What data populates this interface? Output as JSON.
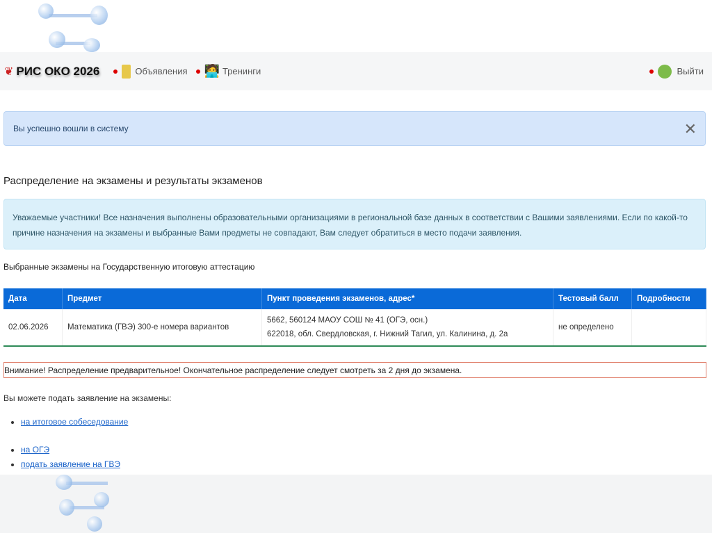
{
  "nav": {
    "brand": "РИС ОКО 2026",
    "items": [
      "Объявления",
      "Тренинги"
    ],
    "logout": "Выйти"
  },
  "alert": {
    "text": "Вы успешно вошли в систему",
    "close": "✕"
  },
  "page_title": "Распределение на экзамены и результаты экзаменов",
  "info": "Уважаемые участники! Все назначения выполнены образовательными организациями в региональной базе данных в соответствии с Вашими заявлениями. Если по какой-то причине назначения на экзамены и выбранные Вами предметы не совпадают, Вам следует обратиться в место подачи заявления.",
  "subtitle": "Выбранные экзамены на Государственную итоговую аттестацию",
  "table": {
    "headers": [
      "Дата",
      "Предмет",
      "Пункт проведения экзаменов, адрес*",
      "Тестовый балл",
      "Подробности"
    ],
    "rows": [
      {
        "date": "02.06.2026",
        "subject": "Математика (ГВЭ) 300-е номера вариантов",
        "place": "5662, 560124 МАОУ СОШ № 41 (ОГЭ, осн.)",
        "address": "622018, обл. Свердловская, г. Нижний Тагил, ул. Калинина, д. 2а",
        "score": "не определено",
        "details": ""
      }
    ]
  },
  "warning": "Внимание! Распределение предварительное! Окончательное распределение следует смотреть за 2 дня до экзамена.",
  "apply_text": "Вы можете подать заявление на экзамены:",
  "links": [
    "на итоговое собеседование",
    "на ОГЭ",
    "подать заявление на ГВЭ"
  ]
}
